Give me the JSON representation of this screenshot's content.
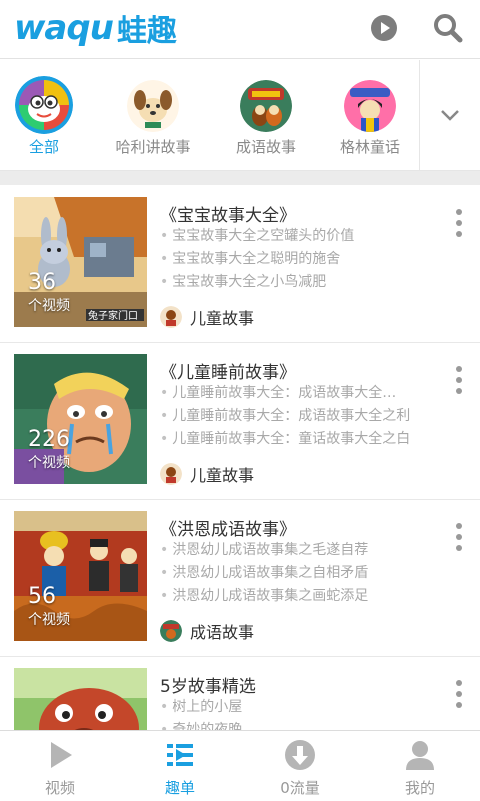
{
  "header": {
    "logo_latin": "waqu",
    "logo_cn": "蛙趣",
    "play_icon": "play-circle-icon",
    "search_icon": "search-icon"
  },
  "categories": [
    {
      "label": "全部",
      "icon": "all-categories-icon"
    },
    {
      "label": "哈利讲故事",
      "icon": "dog-avatar-icon"
    },
    {
      "label": "成语故事",
      "icon": "idiom-story-avatar-icon"
    },
    {
      "label": "格林童话",
      "icon": "grimm-princess-avatar-icon"
    }
  ],
  "items": [
    {
      "title": "《宝宝故事大全》",
      "episodes": [
        "宝宝故事大全之空罐头的价值",
        "宝宝故事大全之聪明的施舍",
        "宝宝故事大全之小鸟减肥"
      ],
      "count": "36",
      "count_unit": "个视频",
      "tag": "儿童故事",
      "thumb_caption": "兔子家门口"
    },
    {
      "title": "《儿童睡前故事》",
      "episodes": [
        "儿童睡前故事大全：成语故事大全…",
        "儿童睡前故事大全：成语故事大全之利",
        "儿童睡前故事大全：童话故事大全之白"
      ],
      "count": "226",
      "count_unit": "个视频",
      "tag": "儿童故事"
    },
    {
      "title": "《洪恩成语故事》",
      "episodes": [
        "洪恩幼儿成语故事集之毛遂自荐",
        "洪恩幼儿成语故事集之自相矛盾",
        "洪恩幼儿成语故事集之画蛇添足"
      ],
      "count": "56",
      "count_unit": "个视频",
      "tag": "成语故事"
    },
    {
      "title": "5岁故事精选",
      "episodes": [
        "树上的小屋",
        "奇妙的夜晚"
      ]
    }
  ],
  "tabs": [
    {
      "label": "视频",
      "icon": "play-triangle-icon"
    },
    {
      "label": "趣单",
      "icon": "list-icon"
    },
    {
      "label": "0流量",
      "icon": "download-icon"
    },
    {
      "label": "我的",
      "icon": "user-icon"
    }
  ],
  "colors": {
    "accent": "#1a9fe0",
    "text_muted": "#a8a8a8"
  }
}
